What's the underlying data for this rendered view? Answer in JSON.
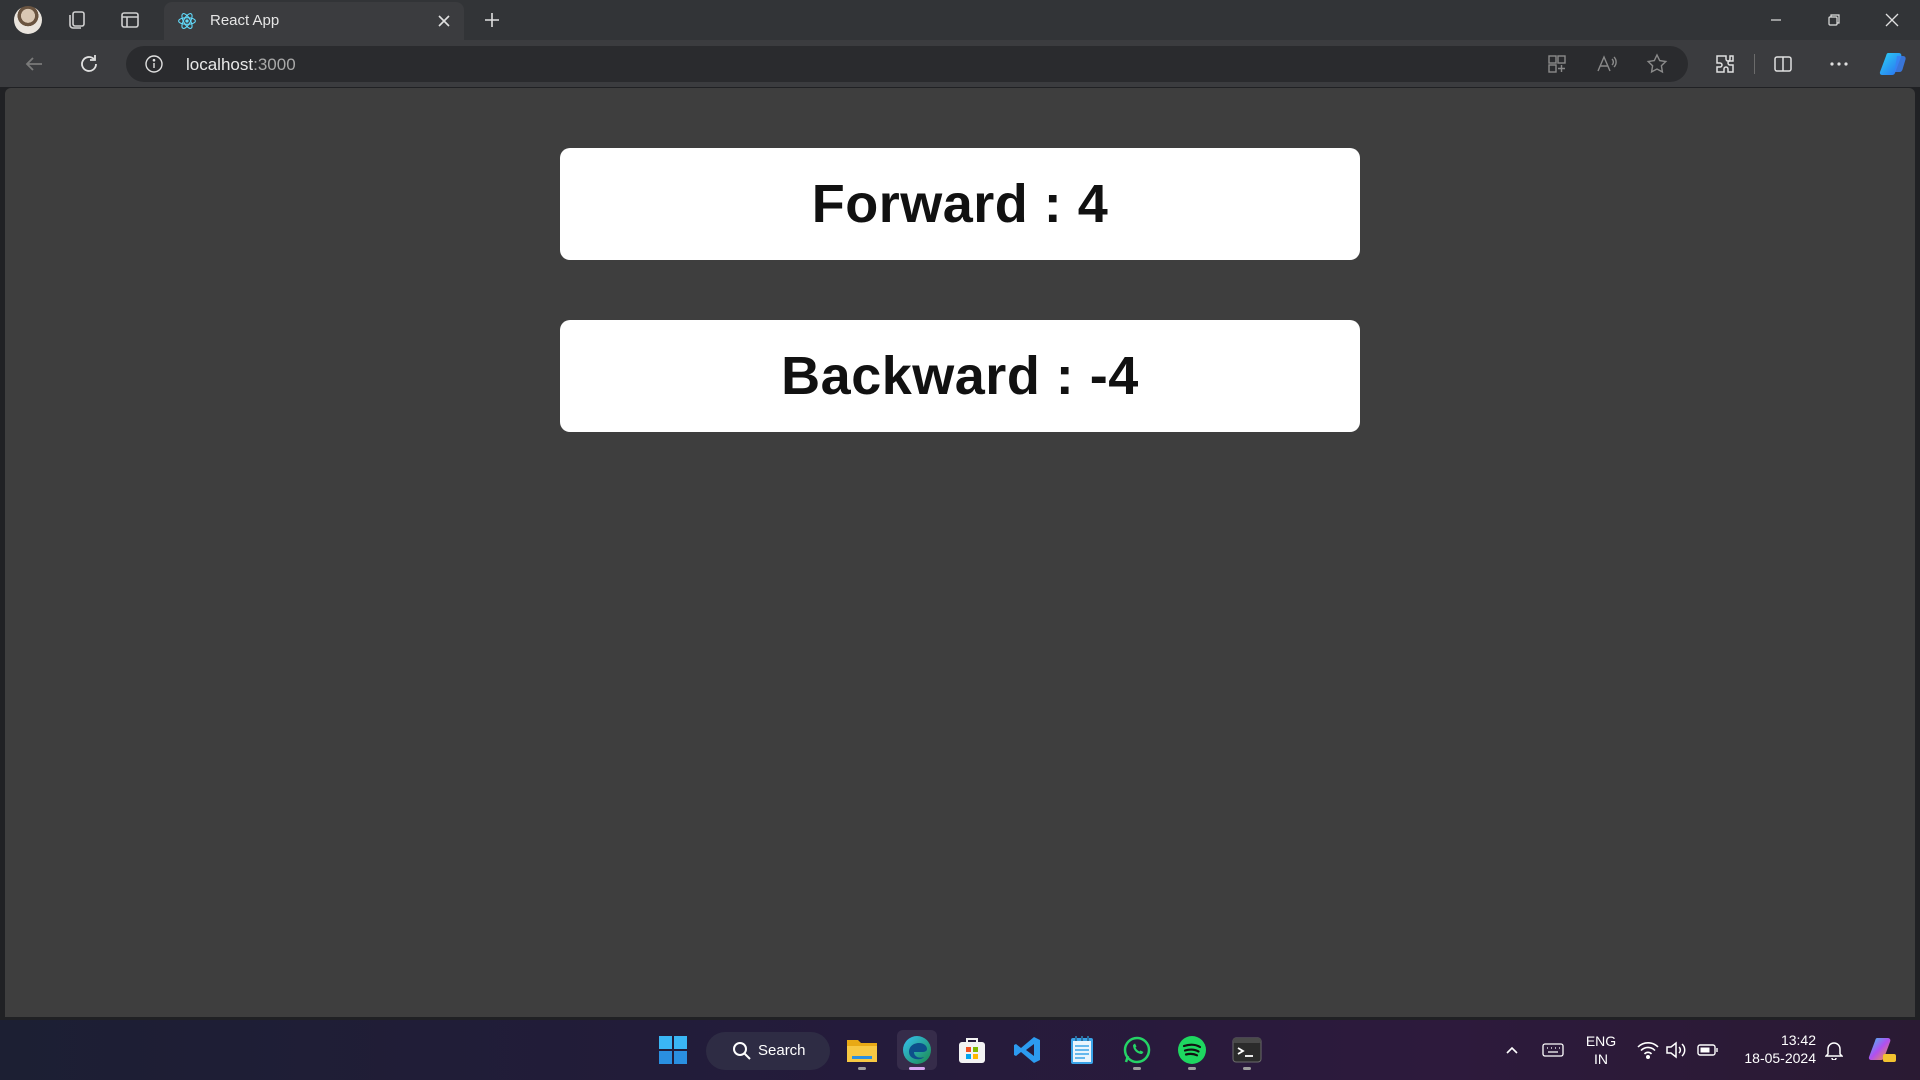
{
  "browser": {
    "tab": {
      "title": "React App"
    },
    "address": {
      "host": "localhost",
      "port": ":3000"
    }
  },
  "page": {
    "forward": {
      "label": "Forward : 4"
    },
    "backward": {
      "label": "Backward : -4"
    }
  },
  "taskbar": {
    "search_label": "Search",
    "language": {
      "lang": "ENG",
      "region": "IN"
    },
    "clock": {
      "time": "13:42",
      "date": "18-05-2024"
    }
  },
  "colors": {
    "page_background": "#3e3e3e",
    "card_background": "#ffffff",
    "card_text": "#111111",
    "browser_chrome": "#323437"
  }
}
